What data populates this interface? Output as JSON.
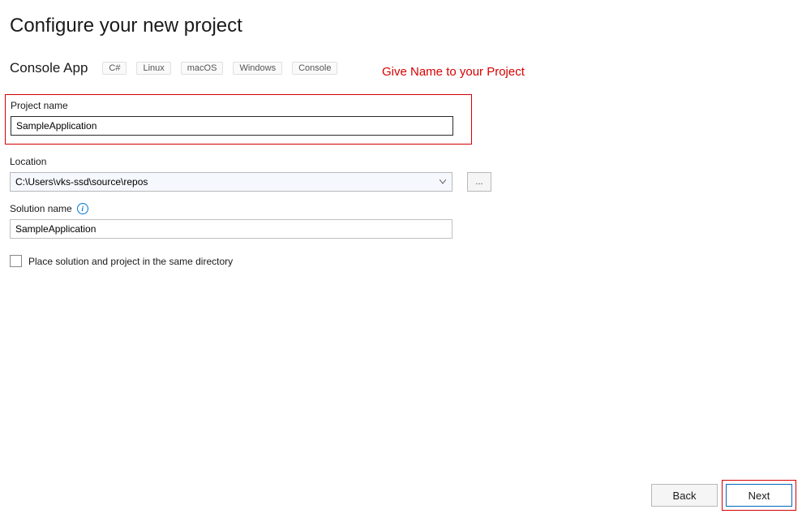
{
  "header": {
    "title": "Configure your new project"
  },
  "template": {
    "name": "Console App",
    "tags": [
      "C#",
      "Linux",
      "macOS",
      "Windows",
      "Console"
    ]
  },
  "annotation": {
    "text": "Give Name to your Project"
  },
  "fields": {
    "projectName": {
      "label": "Project name",
      "value": "SampleApplication"
    },
    "location": {
      "label": "Location",
      "value": "C:\\Users\\vks-ssd\\source\\repos",
      "browseLabel": "..."
    },
    "solutionName": {
      "label": "Solution name",
      "value": "SampleApplication"
    },
    "sameDirectory": {
      "label": "Place solution and project in the same directory"
    }
  },
  "footer": {
    "back": "Back",
    "next": "Next"
  }
}
